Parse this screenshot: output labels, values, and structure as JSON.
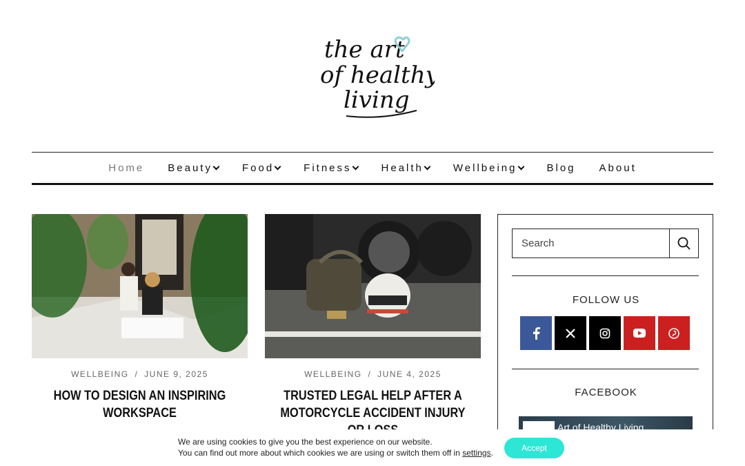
{
  "nav": {
    "items": [
      {
        "label": "Home",
        "dropdown": false
      },
      {
        "label": "Beauty",
        "dropdown": true
      },
      {
        "label": "Food",
        "dropdown": true
      },
      {
        "label": "Fitness",
        "dropdown": true
      },
      {
        "label": "Health",
        "dropdown": true
      },
      {
        "label": "Wellbeing",
        "dropdown": true
      },
      {
        "label": "Blog",
        "dropdown": false
      },
      {
        "label": "About",
        "dropdown": false
      }
    ]
  },
  "posts": [
    {
      "category": "WELLBEING",
      "sep": "/",
      "date": "JUNE 9, 2025",
      "title": "HOW TO DESIGN AN INSPIRING WORKSPACE"
    },
    {
      "category": "WELLBEING",
      "sep": "/",
      "date": "JUNE 4, 2025",
      "title": "TRUSTED LEGAL HELP AFTER A MOTORCYCLE ACCIDENT INJURY OR LOSS"
    }
  ],
  "sidebar": {
    "search_placeholder": "Search",
    "follow_title": "FOLLOW US",
    "socials": [
      {
        "name": "facebook-icon",
        "color": "#3b5998"
      },
      {
        "name": "x-icon",
        "color": "#000000"
      },
      {
        "name": "instagram-icon",
        "color": "#000000"
      },
      {
        "name": "youtube-icon",
        "color": "#cc2020"
      },
      {
        "name": "pinterest-icon",
        "color": "#cc2020"
      }
    ],
    "facebook_title": "FACEBOOK",
    "facebook_page_name": "Art of Healthy Living"
  },
  "cookie": {
    "line1": "We are using cookies to give you the best experience on our website.",
    "line2_prefix": "You can find out more about which cookies we are using or switch them off in ",
    "settings_link": "settings",
    "line2_suffix": ".",
    "accept_label": "Accept",
    "accept_color": "#2ee6d6"
  },
  "logo": {
    "line1": "the art",
    "line2": "of healthy",
    "line3": "living",
    "heart_color": "#8fcfd6"
  }
}
